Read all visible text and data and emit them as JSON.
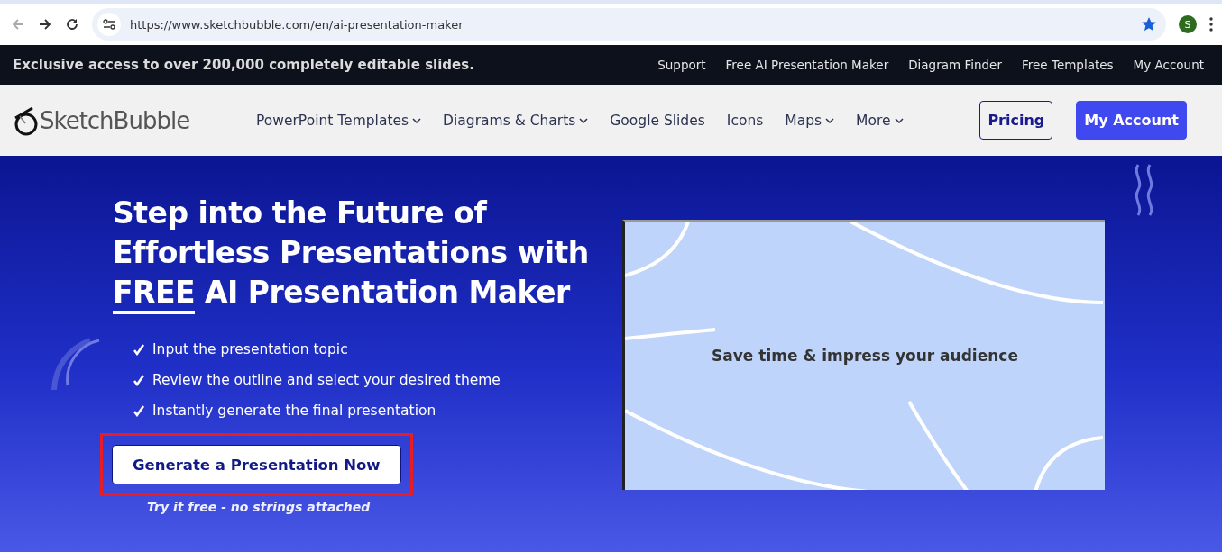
{
  "browser": {
    "url": "https://www.sketchbubble.com/en/ai-presentation-maker",
    "bookmarked": true,
    "profile_initial": "S"
  },
  "top_strip": {
    "text": "Exclusive access to over 200,000 completely editable slides.",
    "links": [
      "Support",
      "Free AI Presentation Maker",
      "Diagram Finder",
      "Free Templates",
      "My Account"
    ]
  },
  "header": {
    "logo_text": "SketchBubble",
    "nav": [
      {
        "label": "PowerPoint Templates",
        "dropdown": true
      },
      {
        "label": "Diagrams & Charts",
        "dropdown": true
      },
      {
        "label": "Google Slides",
        "dropdown": false
      },
      {
        "label": "Icons",
        "dropdown": false
      },
      {
        "label": "Maps",
        "dropdown": true
      },
      {
        "label": "More",
        "dropdown": true
      }
    ],
    "buttons": [
      {
        "label": "Pricing",
        "kind": "outline"
      },
      {
        "label": "My Account",
        "kind": "filled"
      }
    ]
  },
  "hero": {
    "title_start": "Step into the Future of Effortless Presentations with",
    "title_highlight": "FREE",
    "title_end": "AI Presentation Maker",
    "steps": [
      "Input the presentation topic",
      "Review the outline and select your desired theme",
      "Instantly generate the final presentation"
    ],
    "cta": {
      "label": "Generate a Presentation Now",
      "highlighted": true
    },
    "cta_note": "Try it free - no strings attached",
    "slide_preview": {
      "text": "Save time & impress your audience"
    }
  }
}
